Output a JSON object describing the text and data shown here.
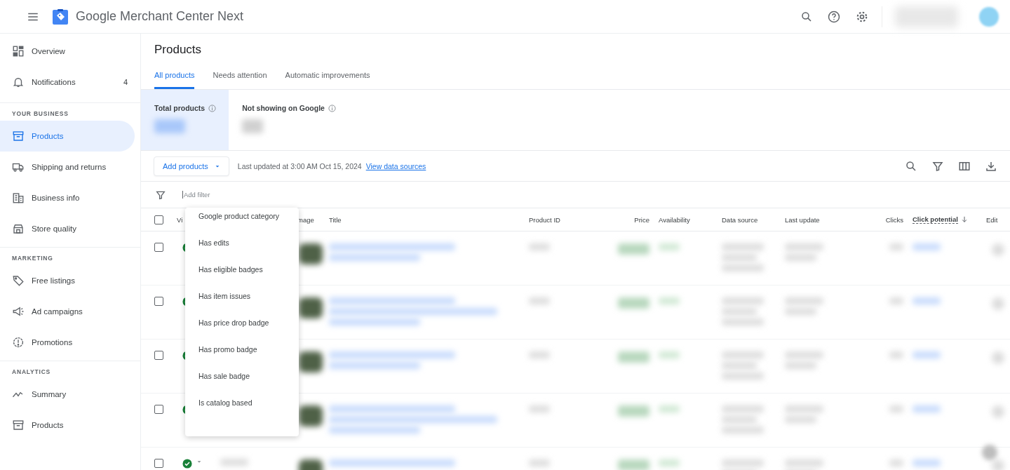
{
  "app": {
    "title": "Google Merchant Center Next"
  },
  "sidebar": {
    "sections": [
      {
        "items": [
          {
            "label": "Overview",
            "selected": false
          },
          {
            "label": "Notifications",
            "badge": "4",
            "selected": false
          }
        ]
      },
      {
        "heading": "YOUR BUSINESS",
        "items": [
          {
            "label": "Products",
            "selected": true
          },
          {
            "label": "Shipping and returns",
            "selected": false
          },
          {
            "label": "Business info",
            "selected": false
          },
          {
            "label": "Store quality",
            "selected": false
          }
        ]
      },
      {
        "heading": "MARKETING",
        "items": [
          {
            "label": "Free listings",
            "selected": false
          },
          {
            "label": "Ad campaigns",
            "selected": false
          },
          {
            "label": "Promotions",
            "selected": false
          }
        ]
      },
      {
        "heading": "ANALYTICS",
        "items": [
          {
            "label": "Summary",
            "selected": false
          },
          {
            "label": "Products",
            "selected": false
          }
        ]
      }
    ]
  },
  "page": {
    "title": "Products",
    "tabs": [
      {
        "label": "All products",
        "selected": true
      },
      {
        "label": "Needs attention",
        "selected": false
      },
      {
        "label": "Automatic improvements",
        "selected": false
      }
    ],
    "stats": [
      {
        "label": "Total products",
        "selected": true
      },
      {
        "label": "Not showing on Google",
        "selected": false
      }
    ],
    "toolbar": {
      "add_button": "Add products",
      "last_updated": "Last updated at 3:00 AM Oct 15, 2024",
      "link": "View data sources"
    },
    "filter": {
      "placeholder": "Add filter"
    },
    "filter_menu": [
      "Google product category",
      "Has edits",
      "Has eligible badges",
      "Has item issues",
      "Has price drop badge",
      "Has promo badge",
      "Has sale badge",
      "Is catalog based"
    ],
    "table": {
      "all_selected": false,
      "columns": [
        {
          "label": "Vi",
          "sorted": false
        },
        {
          "label": "mage",
          "sorted": false
        },
        {
          "label": "Title",
          "sorted": false
        },
        {
          "label": "Product ID",
          "sorted": false
        },
        {
          "label": "Price",
          "sorted": false
        },
        {
          "label": "Availability",
          "sorted": false
        },
        {
          "label": "Data source",
          "sorted": false
        },
        {
          "label": "Last update",
          "sorted": false
        },
        {
          "label": "Clicks",
          "sorted": false
        },
        {
          "label": "Click potential",
          "sorted": true
        },
        {
          "label": "Edit",
          "sorted": false
        }
      ],
      "rows": [
        {
          "selected": false,
          "expandable": false
        },
        {
          "selected": false,
          "expandable": false
        },
        {
          "selected": false,
          "expandable": false
        },
        {
          "selected": false,
          "expandable": false
        },
        {
          "selected": false,
          "expandable": true
        }
      ]
    }
  }
}
